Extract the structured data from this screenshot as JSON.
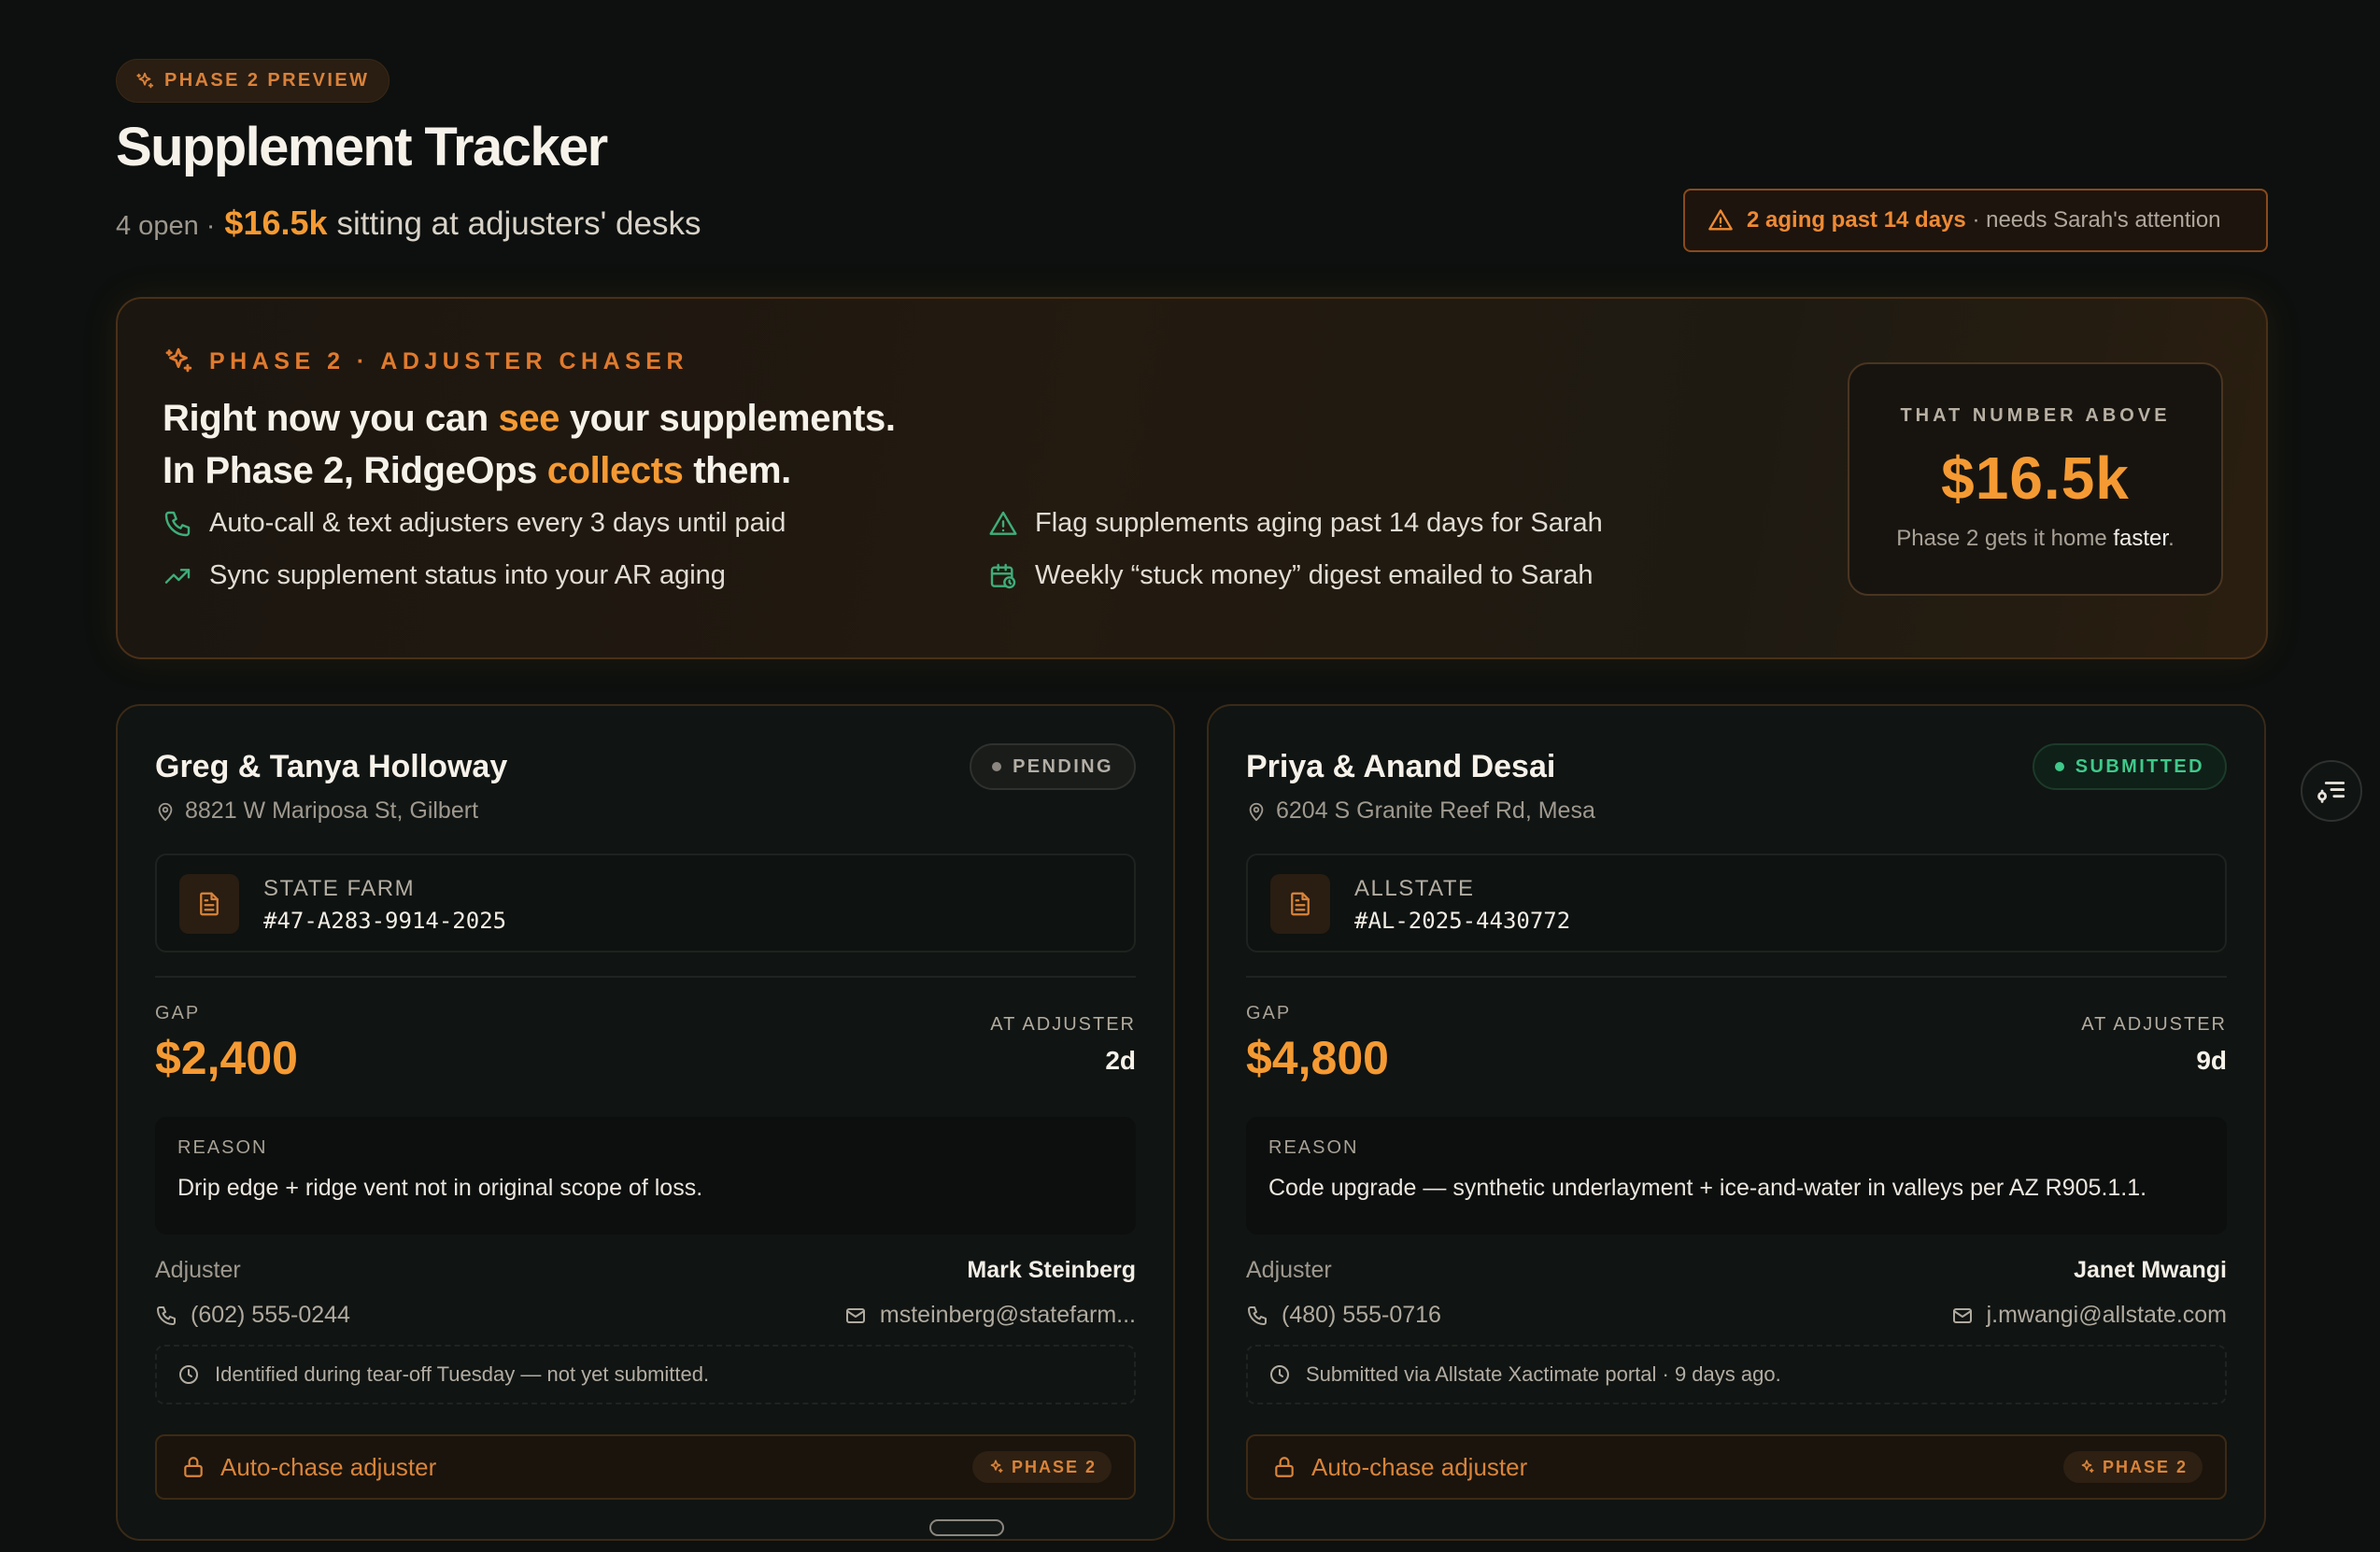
{
  "header": {
    "phase_badge": "PHASE 2 PREVIEW",
    "title": "Supplement Tracker",
    "open_count": "4 open ·",
    "amount": "$16.5k",
    "amount_suffix": "sitting at adjusters' desks",
    "alert_strong": "2 aging past 14 days",
    "alert_rest": "· needs Sarah's attention"
  },
  "hero": {
    "eyebrow": "PHASE 2 · ADJUSTER CHASER",
    "line1_a": "Right now you can ",
    "line1_accent": "see",
    "line1_b": " your supplements.",
    "line2_a": "In Phase 2, RidgeOps ",
    "line2_accent": "collects",
    "line2_b": " them.",
    "features": [
      "Auto-call & text adjusters every 3 days until paid",
      "Sync supplement status into your AR aging",
      "Flag supplements aging past 14 days for Sarah",
      "Weekly “stuck money” digest emailed to Sarah"
    ],
    "callout_label": "THAT NUMBER ABOVE",
    "callout_value": "$16.5k",
    "callout_note_a": "Phase 2 gets it home ",
    "callout_note_b": "faster",
    "callout_note_c": "."
  },
  "cards": [
    {
      "name": "Greg & Tanya Holloway",
      "address": "8821 W Mariposa St, Gilbert",
      "status": "PENDING",
      "carrier": "STATE FARM",
      "claim_number": "#47-A283-9914-2025",
      "gap_label": "GAP",
      "gap": "$2,400",
      "at_adjuster_label": "AT ADJUSTER",
      "days": "2d",
      "reason_label": "REASON",
      "reason": "Drip edge + ridge vent not in original scope of loss.",
      "adjuster_label": "Adjuster",
      "adjuster_name": "Mark Steinberg",
      "phone": "(602) 555-0244",
      "email": "msteinberg@statefarm...",
      "note": "Identified during tear-off Tuesday — not yet submitted.",
      "chase_label": "Auto-chase adjuster",
      "phase_tag": "PHASE 2"
    },
    {
      "name": "Priya & Anand Desai",
      "address": "6204 S Granite Reef Rd, Mesa",
      "status": "SUBMITTED",
      "carrier": "ALLSTATE",
      "claim_number": "#AL-2025-4430772",
      "gap_label": "GAP",
      "gap": "$4,800",
      "at_adjuster_label": "AT ADJUSTER",
      "days": "9d",
      "reason_label": "REASON",
      "reason": "Code upgrade — synthetic underlayment + ice-and-water in valleys per AZ R905.1.1.",
      "adjuster_label": "Adjuster",
      "adjuster_name": "Janet Mwangi",
      "phone": "(480) 555-0716",
      "email": "j.mwangi@allstate.com",
      "note": "Submitted via Allstate Xactimate portal · 9 days ago.",
      "chase_label": "Auto-chase adjuster",
      "phase_tag": "PHASE 2"
    }
  ],
  "colors": {
    "accent": "#f59a33",
    "accent_dark": "#e07a2e",
    "success": "#3fc98a",
    "background": "#0d100e"
  },
  "icons": {
    "sparkle": "sparkle-icon",
    "warning": "warning-triangle-icon",
    "phone": "phone-icon",
    "trend": "trending-up-icon",
    "calendar": "calendar-clock-icon",
    "map_pin": "map-pin-icon",
    "document": "document-icon",
    "mail": "mail-icon",
    "clock": "clock-icon",
    "lock": "lock-icon",
    "filter": "filter-settings-icon"
  }
}
